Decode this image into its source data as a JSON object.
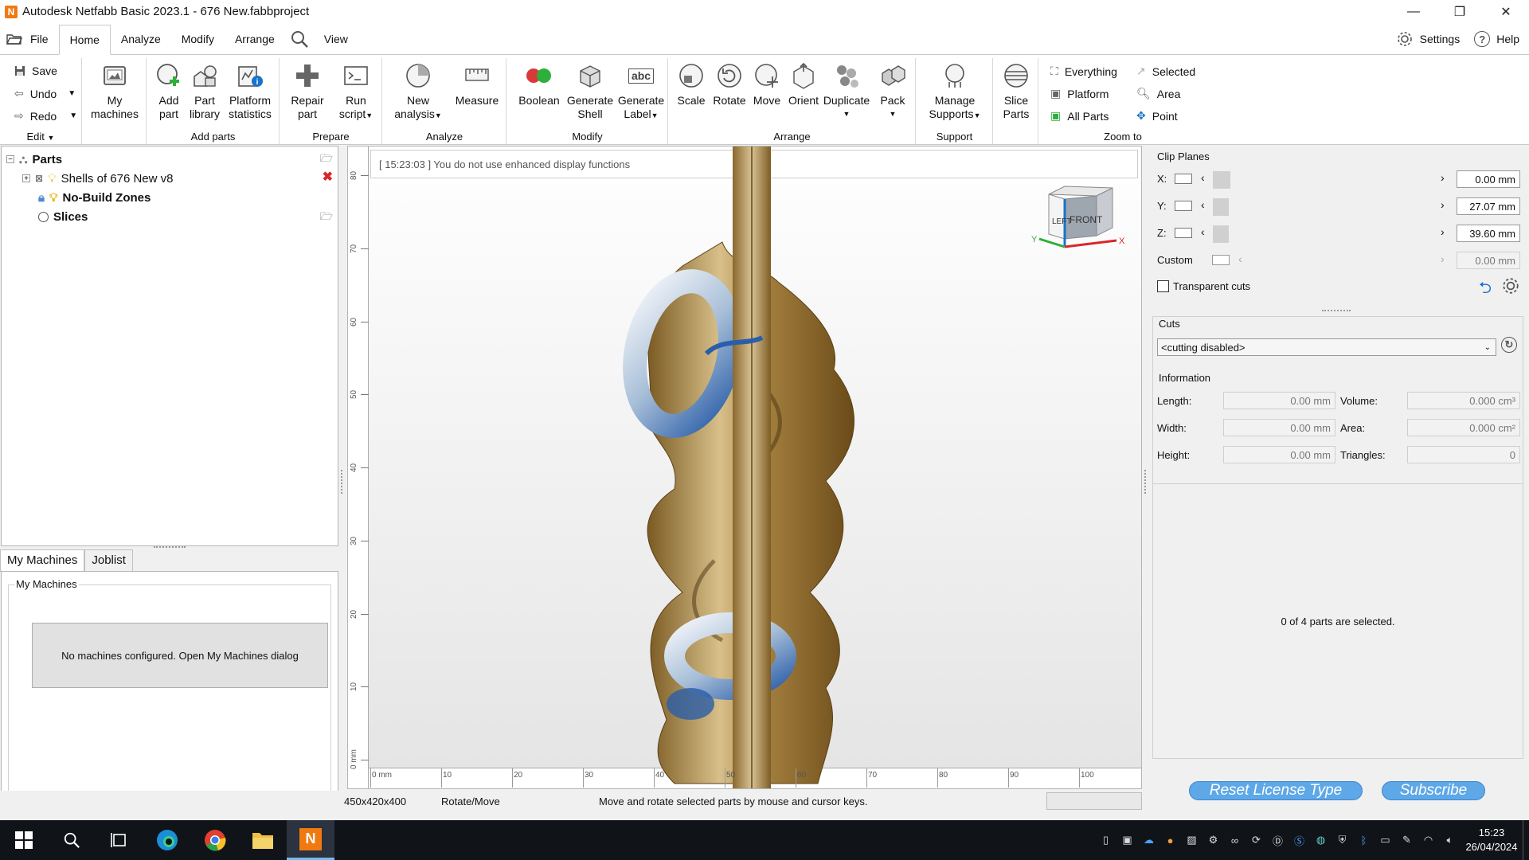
{
  "window": {
    "title": "Autodesk Netfabb Basic 2023.1 - 676 New.fabbproject",
    "app_icon_letter": "N",
    "controls": [
      "—",
      "❐",
      "✕"
    ]
  },
  "menu": {
    "tabs": [
      "File",
      "Home",
      "Analyze",
      "Modify",
      "Arrange",
      "View"
    ],
    "active_tab": "Home",
    "settings_label": "Settings",
    "help_label": "Help"
  },
  "ribbon": {
    "edit": {
      "save": "Save",
      "undo": "Undo",
      "redo": "Redo",
      "group_label": "Edit"
    },
    "my_machines": {
      "line1": "My",
      "line2": "machines"
    },
    "add_parts": {
      "add_part": {
        "line1": "Add",
        "line2": "part"
      },
      "part_library": {
        "line1": "Part",
        "line2": "library"
      },
      "platform_statistics": {
        "line1": "Platform",
        "line2": "statistics"
      },
      "group_label": "Add parts"
    },
    "prepare": {
      "repair_part": {
        "line1": "Repair",
        "line2": "part"
      },
      "run_script": {
        "line1": "Run",
        "line2": "script"
      },
      "group_label": "Prepare"
    },
    "analyze": {
      "new_analysis": {
        "line1": "New",
        "line2": "analysis"
      },
      "measure": "Measure",
      "group_label": "Analyze"
    },
    "modify": {
      "boolean": "Boolean",
      "generate_shell": {
        "line1": "Generate",
        "line2": "Shell"
      },
      "generate_label": {
        "line1": "Generate",
        "line2": "Label"
      },
      "label_icon_text": "abc",
      "group_label": "Modify"
    },
    "arrange": {
      "scale": "Scale",
      "rotate": "Rotate",
      "move": "Move",
      "orient": "Orient",
      "duplicate": "Duplicate",
      "pack": "Pack",
      "group_label": "Arrange"
    },
    "support": {
      "manage_supports": {
        "line1": "Manage",
        "line2": "Supports"
      },
      "group_label": "Support"
    },
    "slice": {
      "line1": "Slice",
      "line2": "Parts"
    },
    "zoom_to": {
      "everything": "Everything",
      "platform": "Platform",
      "all_parts": "All Parts",
      "selected": "Selected",
      "area": "Area",
      "point": "Point",
      "group_label": "Zoom to"
    }
  },
  "parts_tree": {
    "root": "Parts",
    "items": [
      {
        "label": "Shells of 676 New v8",
        "bold": false
      },
      {
        "label": "No-Build Zones",
        "bold": true
      },
      {
        "label": "Slices",
        "bold": true
      }
    ]
  },
  "machines": {
    "tabs": [
      "My Machines",
      "Joblist"
    ],
    "active_tab": "My Machines",
    "group_title": "My Machines",
    "empty_message": "No machines configured. Open My Machines dialog"
  },
  "viewport": {
    "log_message": "[ 15:23:03 ] You do not use enhanced display functions",
    "cube_left": "LEFT",
    "cube_front": "FRONT",
    "axis_x": "X",
    "axis_y": "Y",
    "vertical_ruler": [
      "80",
      "70",
      "60",
      "50",
      "40",
      "30",
      "20",
      "10",
      "0 mm"
    ],
    "horizontal_ruler": [
      "0 mm",
      "10",
      "20",
      "30",
      "40",
      "50",
      "60",
      "70",
      "80",
      "90",
      "100"
    ]
  },
  "clip_planes": {
    "title": "Clip Planes",
    "x": {
      "label": "X:",
      "value": "0.00 mm"
    },
    "y": {
      "label": "Y:",
      "value": "27.07 mm"
    },
    "z": {
      "label": "Z:",
      "value": "39.60 mm"
    },
    "custom": {
      "label": "Custom",
      "value": "0.00 mm"
    },
    "transparent_cuts": "Transparent cuts",
    "transparent_cuts_checked": false
  },
  "cuts": {
    "title": "Cuts",
    "selected": "<cutting disabled>"
  },
  "information": {
    "title": "Information",
    "length": {
      "label": "Length:",
      "value": "0.00 mm"
    },
    "width": {
      "label": "Width:",
      "value": "0.00 mm"
    },
    "height": {
      "label": "Height:",
      "value": "0.00 mm"
    },
    "volume": {
      "label": "Volume:",
      "value": "0.000 cm³"
    },
    "area": {
      "label": "Area:",
      "value": "0.000 cm²"
    },
    "triangles": {
      "label": "Triangles:",
      "value": "0"
    }
  },
  "selection_status": "0 of 4 parts are selected.",
  "buttons": {
    "reset_license": "Reset License Type",
    "subscribe": "Subscribe"
  },
  "statusbar": {
    "platform_size": "450x420x400",
    "mode": "Rotate/Move",
    "hint": "Move and rotate selected parts by mouse and cursor keys."
  },
  "taskbar": {
    "time": "15:23",
    "date": "26/04/2024"
  },
  "colors": {
    "accent_blue": "#1a73c8",
    "pill_blue": "#5ea8e8",
    "netfabb_orange": "#f07a10",
    "wood_dark": "#7a5a22",
    "wood_light": "#d8c08a"
  }
}
